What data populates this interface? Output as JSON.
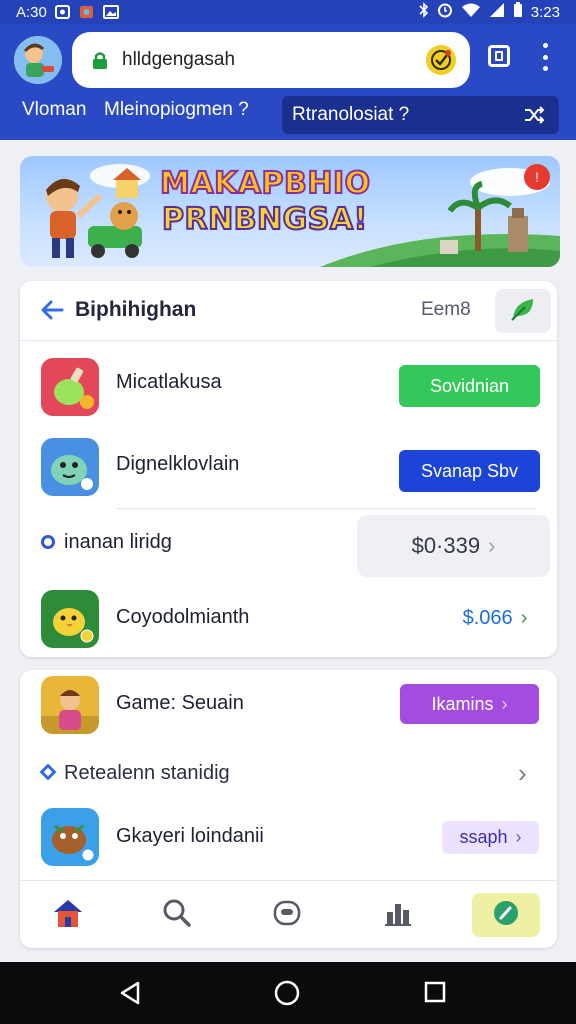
{
  "status_bar": {
    "time": "A:30",
    "clock_right": "3:23"
  },
  "browser": {
    "url": "hlldgengasah",
    "tabs": [
      {
        "label": "Vloman"
      },
      {
        "label": "Mleinopiogmen ?"
      },
      {
        "label": "Rtranolosiat ?"
      }
    ]
  },
  "banner": {
    "line1": "MAKAPBHIO",
    "line2": "PRNBNGSA!",
    "badge": "!"
  },
  "card1": {
    "title": "Biphihighan",
    "meta": "Eem8",
    "rows": [
      {
        "label": "Micatlakusa",
        "action": "Sovidnian",
        "action_color": "#34c759"
      },
      {
        "label": "Dignelklovlain",
        "action": "Svanap Sbv",
        "action_color": "#1d44d8"
      },
      {
        "label": "inanan liridg",
        "action": "$0·339",
        "action_color": "#eef0f3"
      },
      {
        "label": "Coyodolmianth",
        "action": "$.066",
        "action_color": "#1d6fd8"
      }
    ]
  },
  "card2": {
    "rows": [
      {
        "label": "Game: Seuain",
        "action": "Ikamins",
        "action_color": "#a24de0"
      },
      {
        "label": "Retealenn stanidig"
      },
      {
        "label": "Gkayeri loindanii",
        "action": "ssaph",
        "action_color": "#ece2ff"
      }
    ]
  },
  "icons": {
    "home": "home-icon",
    "search": "search-icon",
    "chat": "chat-icon",
    "leaderboard": "leaderboard-icon",
    "edit": "edit-icon"
  }
}
